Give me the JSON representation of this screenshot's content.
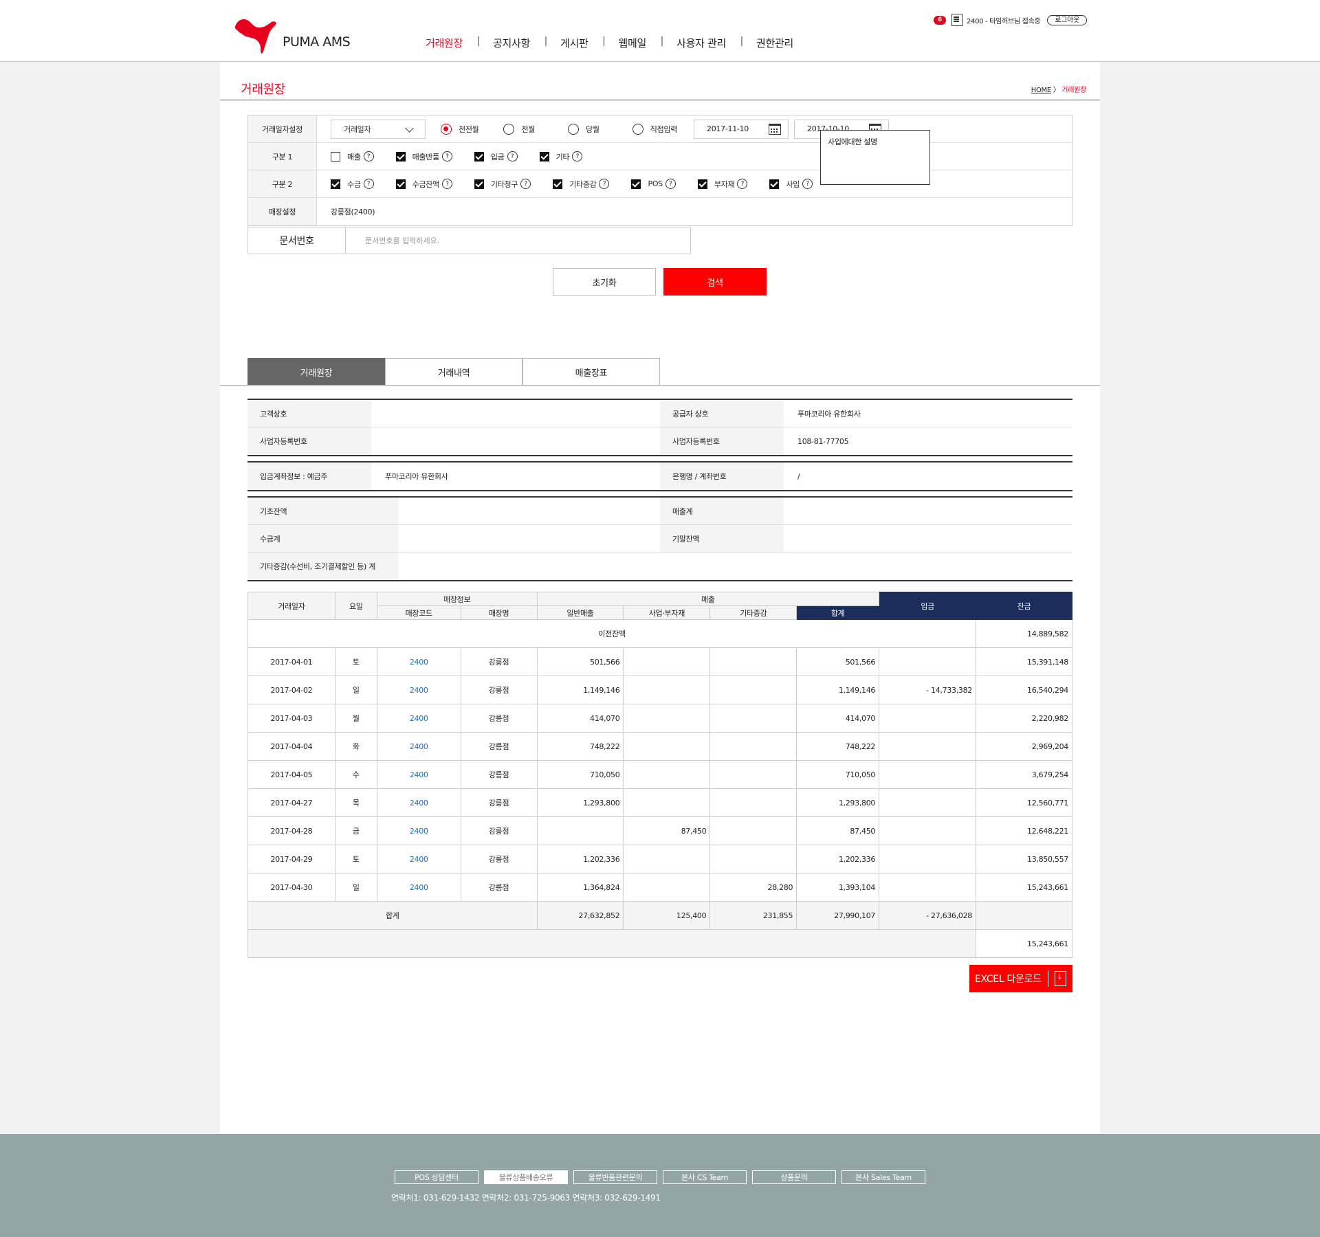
{
  "header": {
    "brand": "PUMA AMS",
    "nav": [
      "거래원장",
      "공지사항",
      "게시판",
      "웹메일",
      "사용자 관리",
      "권한관리"
    ],
    "message_count": "6",
    "user_text": "2400 - 타임허브님 접속중",
    "logout_label": "로그아웃",
    "accent_color": "#e8001c"
  },
  "page": {
    "title": "거래원장",
    "breadcrumb_home": "HOME",
    "breadcrumb_sep": "〉",
    "breadcrumb_current": "거래원장"
  },
  "search": {
    "date_label": "거래일자설정",
    "date_select": "거래일자",
    "radios": [
      "전전월",
      "전월",
      "당월",
      "직접입력"
    ],
    "date_from": "2017-11-10",
    "date_to": "2017-10-10",
    "tooltip": "사입에대한 설명",
    "group1_label": "구분 1",
    "group1": [
      "매출",
      "매출반품",
      "입금",
      "기타"
    ],
    "group2_label": "구분 2",
    "group2": [
      "수금",
      "수금잔액",
      "기타청구",
      "기타증감",
      "POS",
      "부자재",
      "사입"
    ],
    "store_label": "매장설정",
    "store_value": "강릉점(2400)",
    "doc_label": "문서번호",
    "doc_placeholder": "문서번호를 입력하세요.",
    "reset_label": "초기화",
    "search_label": "검색",
    "question_mark": "?"
  },
  "tabs": [
    "거래원장",
    "거래내역",
    "매출장표"
  ],
  "info": {
    "customer_label": "고객상호",
    "customer_value": "",
    "supplier_label": "공급자 상호",
    "supplier_value": "푸마코리아 유한회사",
    "bizno_label": "사업자등록번호",
    "bizno_value": "",
    "supplier_bizno_label": "사업자등록번호",
    "supplier_bizno_value": "108-81-77705",
    "account_label": "입금계좌정보 : 예금주",
    "account_value": "푸마코리아 유한회사",
    "bank_label": "은행명 / 계좌번호",
    "bank_value": "/",
    "opening_label": "기초잔액",
    "sales_total_label": "매출계",
    "collect_label": "수금계",
    "closing_label": "기말잔액",
    "etc_label": "기타증감(수선비, 조기결제할인 등) 계"
  },
  "table": {
    "headers": {
      "date": "거래일자",
      "day": "요일",
      "store_info": "매장정보",
      "store_code": "매장코드",
      "store_name": "매장명",
      "sales": "매출",
      "general": "일반매출",
      "purchase": "사업·부자재",
      "etc": "기타증감",
      "sum": "합계",
      "deposit": "입금",
      "balance": "잔금"
    },
    "prev_label": "이전잔액",
    "prev_balance": "14,889,582",
    "rows": [
      {
        "date": "2017-04-01",
        "day": "토",
        "code": "2400",
        "name": "강릉점",
        "general": "501,566",
        "purchase": "",
        "etc": "",
        "sum": "501,566",
        "deposit": "",
        "balance": "15,391,148"
      },
      {
        "date": "2017-04-02",
        "day": "일",
        "code": "2400",
        "name": "강릉점",
        "general": "1,149,146",
        "purchase": "",
        "etc": "",
        "sum": "1,149,146",
        "deposit": "- 14,733,382",
        "balance": "16,540,294"
      },
      {
        "date": "2017-04-03",
        "day": "월",
        "code": "2400",
        "name": "강릉점",
        "general": "414,070",
        "purchase": "",
        "etc": "",
        "sum": "414,070",
        "deposit": "",
        "balance": "2,220,982"
      },
      {
        "date": "2017-04-04",
        "day": "화",
        "code": "2400",
        "name": "강릉점",
        "general": "748,222",
        "purchase": "",
        "etc": "",
        "sum": "748,222",
        "deposit": "",
        "balance": "2,969,204"
      },
      {
        "date": "2017-04-05",
        "day": "수",
        "code": "2400",
        "name": "강릉점",
        "general": "710,050",
        "purchase": "",
        "etc": "",
        "sum": "710,050",
        "deposit": "",
        "balance": "3,679,254"
      },
      {
        "date": "2017-04-27",
        "day": "목",
        "code": "2400",
        "name": "강릉점",
        "general": "1,293,800",
        "purchase": "",
        "etc": "",
        "sum": "1,293,800",
        "deposit": "",
        "balance": "12,560,771"
      },
      {
        "date": "2017-04-28",
        "day": "금",
        "code": "2400",
        "name": "강릉점",
        "general": "",
        "purchase": "87,450",
        "etc": "",
        "sum": "87,450",
        "deposit": "",
        "balance": "12,648,221"
      },
      {
        "date": "2017-04-29",
        "day": "토",
        "code": "2400",
        "name": "강릉점",
        "general": "1,202,336",
        "purchase": "",
        "etc": "",
        "sum": "1,202,336",
        "deposit": "",
        "balance": "13,850,557"
      },
      {
        "date": "2017-04-30",
        "day": "일",
        "code": "2400",
        "name": "강릉점",
        "general": "1,364,824",
        "purchase": "",
        "etc": "28,280",
        "sum": "1,393,104",
        "deposit": "",
        "balance": "15,243,661"
      }
    ],
    "total_label": "합계",
    "total": {
      "general": "27,632,852",
      "purchase": "125,400",
      "etc": "231,855",
      "sum": "27,990,107",
      "deposit": "- 27,636,028"
    },
    "final_balance": "15,243,661"
  },
  "excel_label": "EXCEL 다운로드",
  "footer": {
    "buttons": [
      "POS 상담센터",
      "물류상품배송오류",
      "물류반품관련문의",
      "본사 CS Team",
      "상품문의",
      "본사 Sales Team"
    ],
    "contact": "연락처1: 031-629-1432   연락처2: 031-725-9063   연락처3: 032-629-1491"
  }
}
